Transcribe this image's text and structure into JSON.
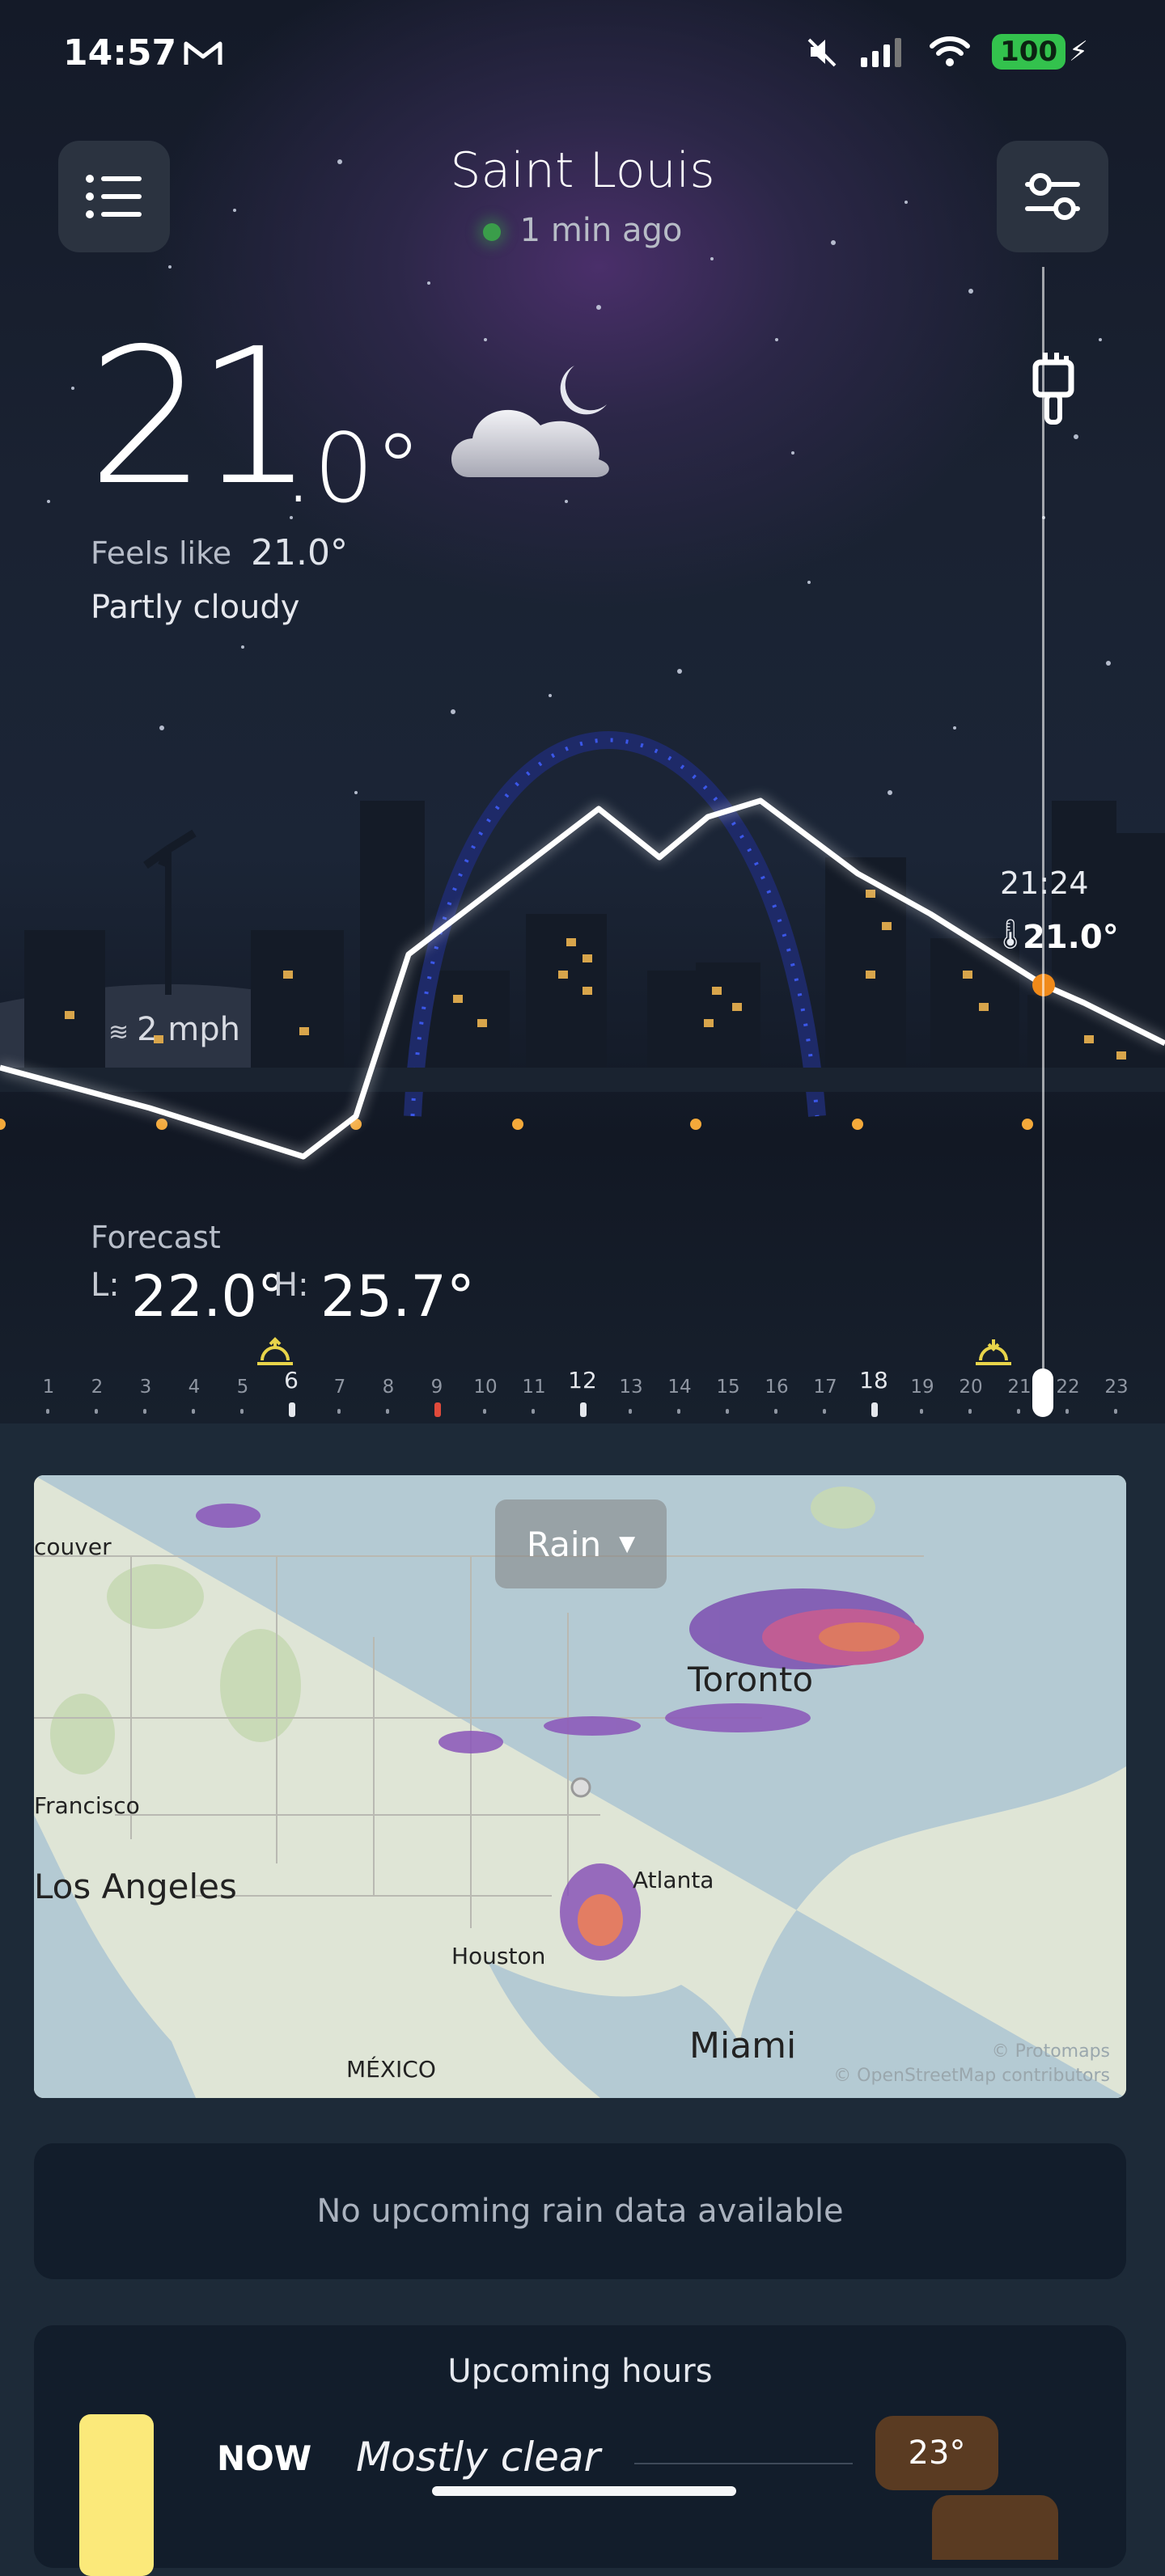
{
  "status_bar": {
    "time": "14:57",
    "battery": "100"
  },
  "header": {
    "city": "Saint Louis",
    "updated": "1 min ago"
  },
  "current": {
    "temp_int": "21",
    "temp_dec": ".0°",
    "feels_like_label": "Feels like",
    "feels_like_value": "21.0°",
    "condition": "Partly cloudy",
    "wind": "2 mph"
  },
  "scrubber": {
    "time": "21:24",
    "temp": "21.0°"
  },
  "forecast": {
    "label": "Forecast",
    "low_label": "L:",
    "low_value": "22.0°",
    "high_label": "H:",
    "high_value": "25.7°"
  },
  "timeline": {
    "hours": [
      "1",
      "2",
      "3",
      "4",
      "5",
      "6",
      "7",
      "8",
      "9",
      "10",
      "11",
      "12",
      "13",
      "14",
      "15",
      "16",
      "17",
      "18",
      "19",
      "20",
      "21",
      "22",
      "23"
    ],
    "major": [
      "6",
      "12",
      "18"
    ]
  },
  "map": {
    "layer_button": "Rain",
    "labels": [
      "couver",
      "Francisco",
      "Los Angeles",
      "Toronto",
      "Atlanta",
      "Houston",
      "Miami",
      "MÉXICO"
    ],
    "attribution": [
      "© Protomaps",
      "© OpenStreetMap contributors"
    ]
  },
  "rain_card": {
    "message": "No upcoming rain data available"
  },
  "upcoming": {
    "title": "Upcoming hours",
    "now_label": "NOW",
    "now_condition": "Mostly clear",
    "now_temp": "23°"
  },
  "colors": {
    "accent_orange": "#f08a1a",
    "now_pill": "#5a3b22",
    "card_bg": "#121d2b",
    "battery_green": "#33c24d"
  }
}
